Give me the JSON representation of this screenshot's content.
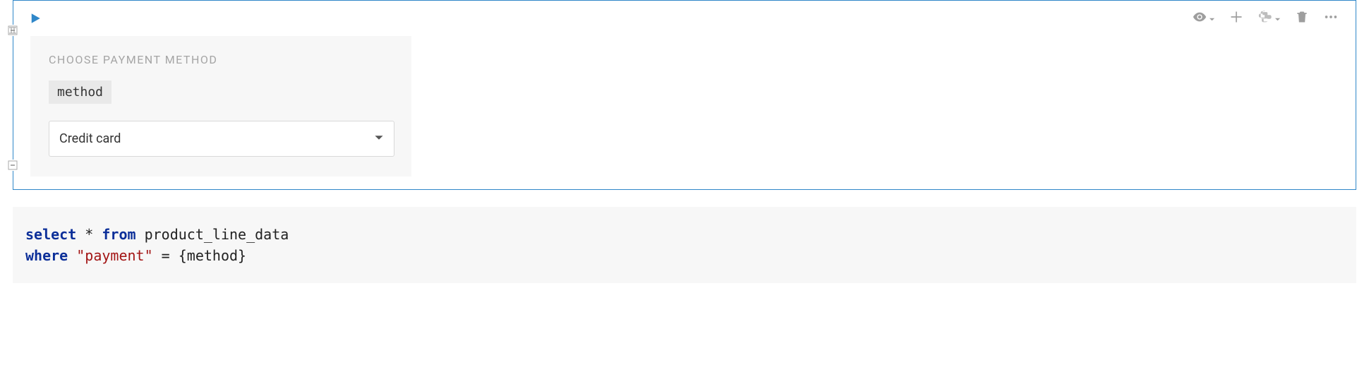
{
  "form": {
    "title": "CHOOSE PAYMENT METHOD",
    "variable_name": "method",
    "selected_value": "Credit card"
  },
  "sql": {
    "keyword_select": "select",
    "star": " * ",
    "keyword_from": "from",
    "table": " product_line_data",
    "keyword_where": "where",
    "column_quoted": " \"payment\"",
    "equals": " = ",
    "template": "{method}"
  },
  "toolbar": {
    "visibility_icon": "eye-icon",
    "add_icon": "plus-icon",
    "kernel_icon": "python-icon",
    "delete_icon": "trash-icon",
    "more_icon": "more-icon"
  }
}
